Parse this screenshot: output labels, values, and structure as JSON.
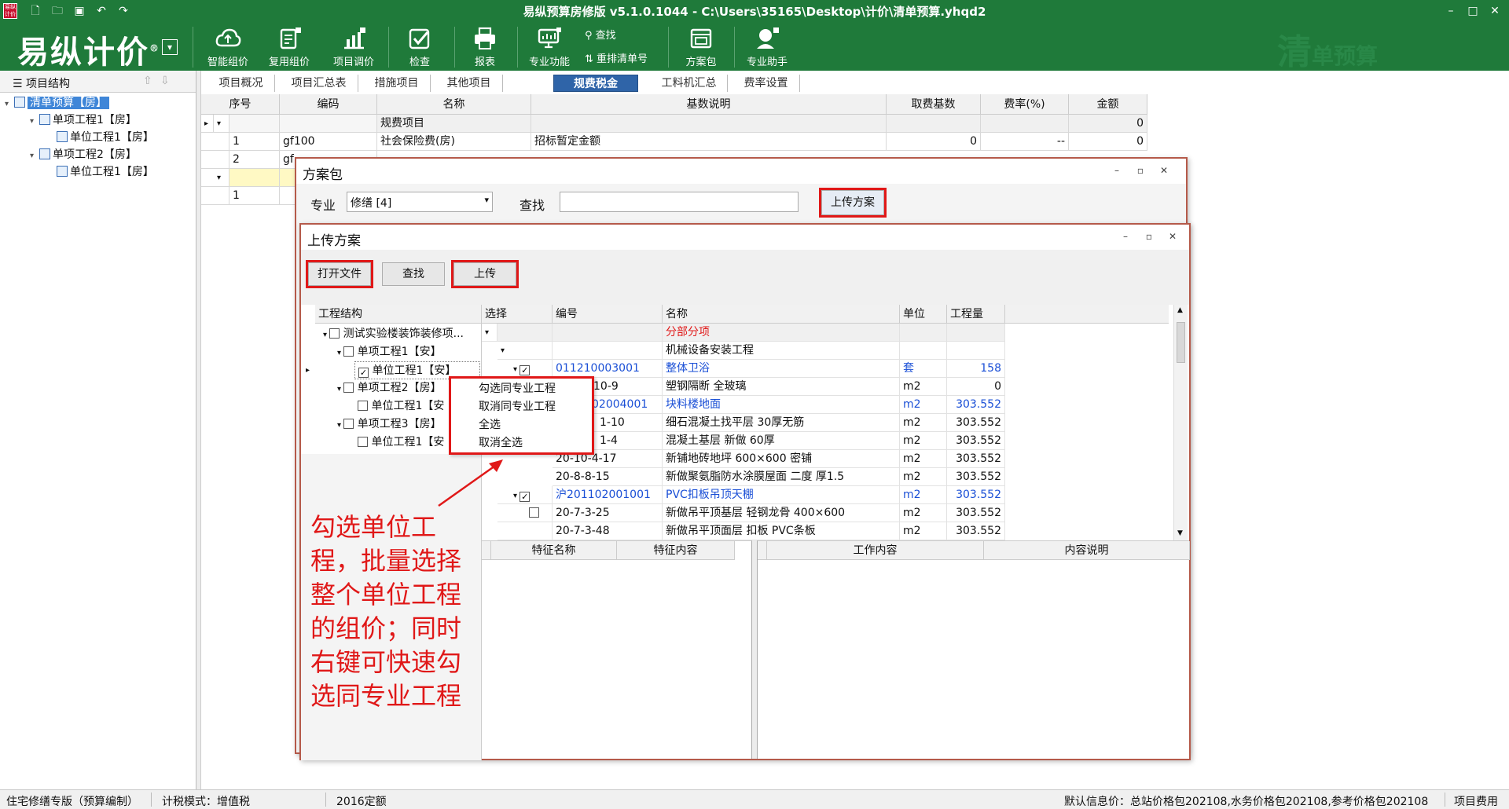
{
  "app": {
    "title": "易纵预算房修版 v5.1.0.1044 - C:\\Users\\35165\\Desktop\\计价\\清单预算.yhqd2",
    "logo": "易纵计价",
    "logo_mark": "®",
    "brand_big": "清",
    "brand_small": "单预算",
    "brand_color": "#1f7a3a"
  },
  "ribbon": {
    "buttons": [
      {
        "label": "智能组价",
        "icon": "cloud-icon"
      },
      {
        "label": "复用组价",
        "icon": "clipboard-icon"
      },
      {
        "label": "项目调价",
        "icon": "chart-icon"
      },
      {
        "label": "检查",
        "icon": "checkmark-icon"
      },
      {
        "label": "报表",
        "icon": "printer-icon"
      },
      {
        "label": "专业功能",
        "icon": "monitor-icon"
      },
      {
        "label": "方案包",
        "icon": "package-icon"
      },
      {
        "label": "专业助手",
        "icon": "assistant-icon"
      }
    ],
    "find_label": "查找",
    "renumber_label": "重排清单号"
  },
  "left_panel": {
    "header": "项目结构",
    "tree": [
      {
        "label": "清单预算【房】",
        "level": 0,
        "selected": true
      },
      {
        "label": "单项工程1【房】",
        "level": 1
      },
      {
        "label": "单位工程1【房】",
        "level": 2
      },
      {
        "label": "单项工程2【房】",
        "level": 1
      },
      {
        "label": "单位工程1【房】",
        "level": 2
      }
    ]
  },
  "tabs": [
    "项目概况",
    "项目汇总表",
    "措施项目",
    "其他项目",
    "规费税金",
    "工料机汇总",
    "费率设置"
  ],
  "active_tab": "规费税金",
  "main_grid": {
    "headers": [
      "序号",
      "编码",
      "名称",
      "基数说明",
      "取费基数",
      "费率(%)",
      "金额"
    ],
    "rows": [
      {
        "seq": "",
        "code": "",
        "name": "规费项目",
        "basis": "",
        "base": "",
        "rate": "",
        "amount": "0"
      },
      {
        "seq": "1",
        "code": "gf100",
        "name": "社会保险费(房)",
        "basis": "招标暂定金额",
        "base": "0",
        "rate": "--",
        "amount": "0"
      },
      {
        "seq": "2",
        "code": "gf",
        "name": "",
        "basis": "",
        "base": "",
        "rate": "",
        "amount": ""
      },
      {
        "seq": "",
        "code": "",
        "name": "",
        "basis": "",
        "base": "",
        "rate": "",
        "amount": ""
      },
      {
        "seq": "1",
        "code": "",
        "name": "",
        "basis": "",
        "base": "",
        "rate": "",
        "amount": ""
      }
    ]
  },
  "plan_dialog": {
    "title": "方案包",
    "specialty_label": "专业",
    "specialty_value": "修缮 [4]",
    "find_label": "查找",
    "find_value": "",
    "upload_plan_button": "上传方案"
  },
  "upload_dialog": {
    "title": "上传方案",
    "open_file_button": "打开文件",
    "find_button": "查找",
    "upload_button": "上传",
    "structure_header": "工程结构",
    "structure": [
      {
        "label": "测试实验楼装饰装修项...",
        "level": 0,
        "checked": false
      },
      {
        "label": "单项工程1【安】",
        "level": 1,
        "checked": false
      },
      {
        "label": "单位工程1【安】",
        "level": 2,
        "checked": true
      },
      {
        "label": "单项工程2【房】",
        "level": 1,
        "checked": false
      },
      {
        "label": "单位工程1【安",
        "level": 2,
        "checked": false
      },
      {
        "label": "单项工程3【房】",
        "level": 1,
        "checked": false
      },
      {
        "label": "单位工程1【安",
        "level": 2,
        "checked": false
      }
    ],
    "list_headers": [
      "选择",
      "编号",
      "名称",
      "单位",
      "工程量"
    ],
    "list_rows": [
      {
        "code": "",
        "name": "分部分项",
        "unit": "",
        "qty": "",
        "style": "red"
      },
      {
        "code": "",
        "name": "机械设备安装工程",
        "unit": "",
        "qty": "",
        "style": ""
      },
      {
        "code": "011210003001",
        "name": "整体卫浴",
        "unit": "套",
        "qty": "158",
        "style": "blue",
        "checked": true
      },
      {
        "code": "10-9",
        "name": "塑钢隔断 全玻璃",
        "unit": "m2",
        "qty": "0",
        "style": ""
      },
      {
        "code": "02004001",
        "name": "块料楼地面",
        "unit": "m2",
        "qty": "303.552",
        "style": "blue"
      },
      {
        "code": "1-10",
        "name": "细石混凝土找平层 30厚无筋",
        "unit": "m2",
        "qty": "303.552",
        "style": ""
      },
      {
        "code": "1-4",
        "name": "混凝土基层 新做 60厚",
        "unit": "m2",
        "qty": "303.552",
        "style": ""
      },
      {
        "code": "20-10-4-17",
        "name": "新铺地砖地坪 600×600 密铺",
        "unit": "m2",
        "qty": "303.552",
        "style": ""
      },
      {
        "code": "20-8-8-15",
        "name": "新做聚氨脂防水涂膜屋面 二度 厚1.5",
        "unit": "m2",
        "qty": "303.552",
        "style": ""
      },
      {
        "code": "沪201102001001",
        "name": "PVC扣板吊顶天棚",
        "unit": "m2",
        "qty": "303.552",
        "style": "blue",
        "checked": true
      },
      {
        "code": "20-7-3-25",
        "name": "新做吊平顶基层 轻钢龙骨 400×600",
        "unit": "m2",
        "qty": "303.552",
        "style": ""
      },
      {
        "code": "20-7-3-48",
        "name": "新做吊平顶面层 扣板 PVC条板",
        "unit": "m2",
        "qty": "303.552",
        "style": ""
      }
    ],
    "feature_headers": [
      "特征名称",
      "特征内容"
    ],
    "work_headers": [
      "工作内容",
      "内容说明"
    ]
  },
  "context_menu": [
    "勾选同专业工程",
    "取消同专业工程",
    "全选",
    "取消全选"
  ],
  "annotation": "勾选单位工程，批量选择整个单位工程的组价；同时右键可快速勾选同专业工程",
  "status_bar": {
    "edition": "住宅修缮专版（预算编制）",
    "tax_mode": "计税模式：增值税",
    "quota": "2016定额",
    "price_info": "默认信息价：总站价格包202108,水务价格包202108,参考价格包202108",
    "project_fee": "项目费用"
  }
}
